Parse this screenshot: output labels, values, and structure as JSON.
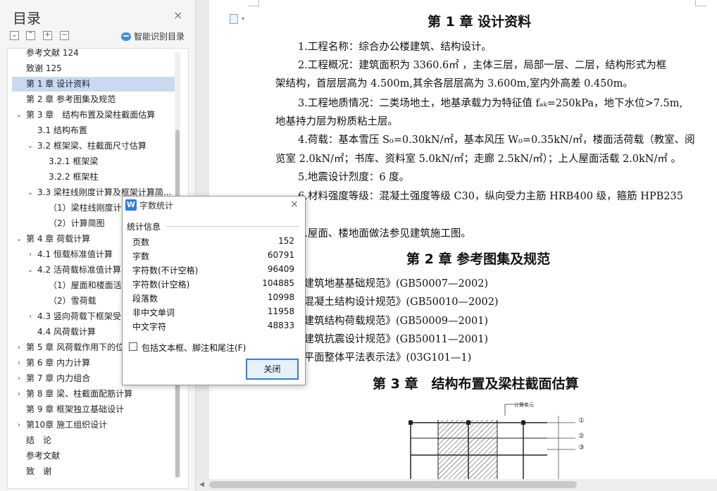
{
  "nav": {
    "title": "目录",
    "close_glyph": "×",
    "smart_toc": "智能识别目录",
    "tools": [
      "⌄",
      "⌃",
      "+",
      "−"
    ],
    "items": [
      {
        "label": "参考文献 124",
        "level": 1,
        "arrow": ""
      },
      {
        "label": "致谢 125",
        "level": 1,
        "arrow": ""
      },
      {
        "label": "第 1 章 设计资料",
        "level": 1,
        "arrow": "",
        "selected": true
      },
      {
        "label": "第 2 章 参考图集及规范",
        "level": 1,
        "arrow": ""
      },
      {
        "label": "第 3 章　结构布置及梁柱截面估算",
        "level": 1,
        "arrow": "⌄"
      },
      {
        "label": "3.1 结构布置",
        "level": 2,
        "arrow": ""
      },
      {
        "label": "3.2 框架梁、柱截面尺寸估算",
        "level": 2,
        "arrow": "⌄"
      },
      {
        "label": "3.2.1 框架梁",
        "level": 3,
        "arrow": ""
      },
      {
        "label": "3.2.2 框架柱",
        "level": 3,
        "arrow": ""
      },
      {
        "label": "3.3 梁柱线刚度计算及框架计算简...",
        "level": 2,
        "arrow": "⌄"
      },
      {
        "label": "（1）梁柱线刚度计",
        "level": 3,
        "arrow": ""
      },
      {
        "label": "（2）计算简图",
        "level": 3,
        "arrow": ""
      },
      {
        "label": "第 4 章  荷载计算",
        "level": 1,
        "arrow": "⌄"
      },
      {
        "label": "4.1 恒载标准值计算",
        "level": 2,
        "arrow": "›"
      },
      {
        "label": "4.2 活荷载标准值计算",
        "level": 2,
        "arrow": "⌄"
      },
      {
        "label": "（1）屋面和楼面活",
        "level": 3,
        "arrow": ""
      },
      {
        "label": "（2）雪荷载",
        "level": 3,
        "arrow": ""
      },
      {
        "label": "4.3 竖向荷载下框架受",
        "level": 2,
        "arrow": "›"
      },
      {
        "label": "4.4 风荷载计算",
        "level": 2,
        "arrow": ""
      },
      {
        "label": "第 5 章  风荷载作用下的位",
        "level": 1,
        "arrow": "›"
      },
      {
        "label": "第 6 章    内力计算",
        "level": 1,
        "arrow": "›"
      },
      {
        "label": "第 7 章    内力组合",
        "level": 1,
        "arrow": "›"
      },
      {
        "label": "第 8 章    梁、柱截面配筋计算",
        "level": 1,
        "arrow": "›"
      },
      {
        "label": "第 9 章  框架独立基础设计",
        "level": 1,
        "arrow": ""
      },
      {
        "label": "第10章    施工组织设计",
        "level": 1,
        "arrow": "›"
      },
      {
        "label": "结　论",
        "level": 1,
        "arrow": ""
      },
      {
        "label": "参考文献",
        "level": 1,
        "arrow": ""
      },
      {
        "label": "致　谢",
        "level": 1,
        "arrow": ""
      }
    ]
  },
  "document": {
    "ch1_title": "第 1 章  设计资料",
    "p1": "1.工程名称：综合办公楼建筑、结构设计。",
    "p2a": "2.工程概况：建筑面积为 3360.6㎡ ，主体三层，局部一层、二层，结构形式为框",
    "p2b": "架结构，首层层高为 4.500m,其余各层层高为 3.600m,室内外高差 0.450m。",
    "p3a": "3.工程地质情况：二类场地土，地基承载力为特征值 fₐₖ=250kPa，地下水位>7.5m,",
    "p3b": "地基持力层为粉质粘土层。",
    "p4a": "4.荷载：基本雪压 S₀=0.30kN/㎡，基本风压 W₀=0.35kN/㎡，楼面活荷载（教室、阅",
    "p4b": "览室 2.0kN/㎡；书库、资料室 5.0kN/㎡；走廊 2.5kN/㎡）；上人屋面活载 2.0kN/㎡ 。",
    "p5": "5.地震设计烈度：6 度。",
    "p6": "6.材料强度等级：混凝土强度等级 C30，纵向受力主筋 HRB400 级，箍筋 HPB235",
    "p7": "7.屋面、楼地面做法参见建筑施工图。",
    "ch2_title": "第 2 章  参考图集及规范",
    "refs": [
      "《建筑地基基础规范》(GB50007—2002)",
      "《混凝土结构设计规范》(GB50010—2002)",
      "《建筑结构荷载规范》(GB50009—2001)",
      "《建筑抗震设计规范》(GB50011—2001)",
      "《平面整体平法表示法》(03G101—1)"
    ],
    "ch3_title": "第 3 章　结构布置及梁柱截面估算",
    "drawing_label": "计算单元",
    "axis_labels": [
      "①",
      "②",
      "③"
    ]
  },
  "dialog": {
    "icon": "W",
    "title": "字数统计",
    "close_glyph": "×",
    "section": "统计信息",
    "stats": [
      {
        "label": "页数",
        "value": "152"
      },
      {
        "label": "字数",
        "value": "60791"
      },
      {
        "label": "字符数(不计空格)",
        "value": "96409"
      },
      {
        "label": "字符数(计空格)",
        "value": "104885"
      },
      {
        "label": "段落数",
        "value": "10998"
      },
      {
        "label": "非中文单词",
        "value": "11958"
      },
      {
        "label": "中文字符",
        "value": "48833"
      }
    ],
    "checkbox_label": "包括文本框、脚注和尾注(F)",
    "checkbox_checked": false,
    "close_button": "关闭"
  },
  "colors": {
    "selected": "#c8d9f2",
    "accent": "#3a7bd5"
  }
}
